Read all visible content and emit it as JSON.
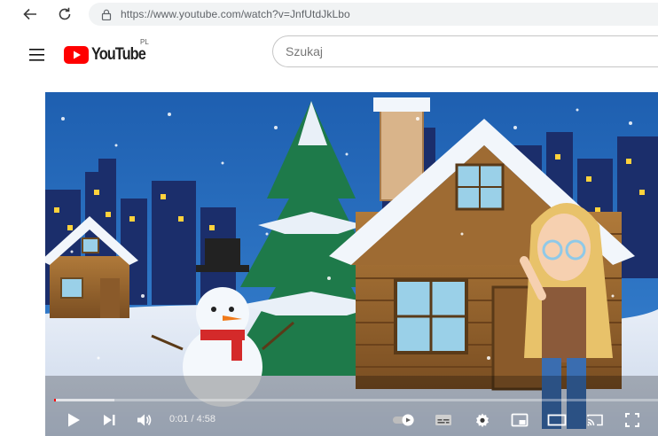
{
  "browser": {
    "url": "https://www.youtube.com/watch?v=JnfUtdJkLbo",
    "back_icon": "arrow-left-icon",
    "reload_icon": "reload-icon",
    "security_icon": "lock-icon"
  },
  "header": {
    "menu_icon": "hamburger-icon",
    "logo_text": "YouTube",
    "country_code": "PL",
    "search_placeholder": "Szukaj",
    "brand_color": "#ff0000"
  },
  "player": {
    "current_time": "0:01",
    "time_separator": " / ",
    "duration": "4:58",
    "progress_fraction": 0.003,
    "buffered_fraction": 0.1,
    "controls": [
      "play-icon",
      "next-icon",
      "volume-icon",
      "autoplay-toggle-icon",
      "subtitles-icon",
      "settings-icon",
      "miniplayer-icon",
      "theater-mode-icon",
      "cast-icon",
      "fullscreen-icon"
    ]
  }
}
